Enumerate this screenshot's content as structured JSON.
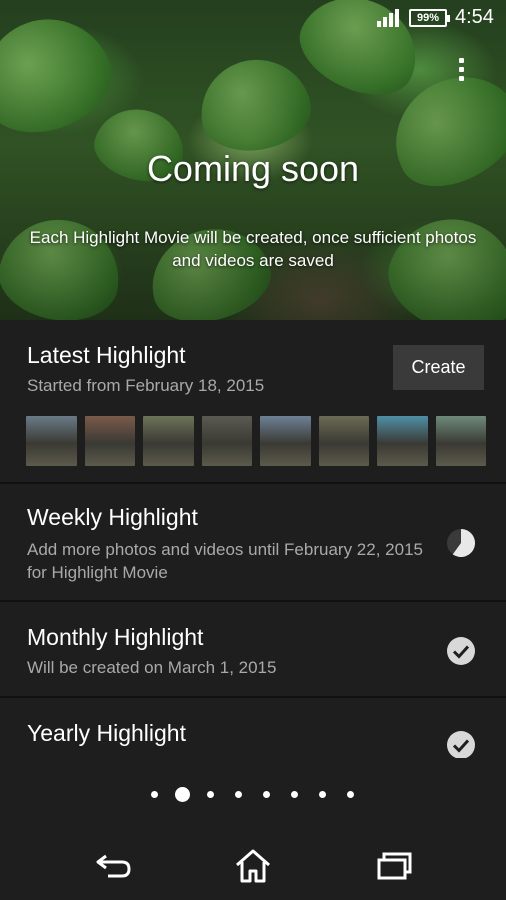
{
  "status_bar": {
    "battery": "99%",
    "time": "4:54"
  },
  "hero": {
    "title": "Coming soon",
    "description": "Each Highlight Movie will be created, once sufficient photos and videos are saved"
  },
  "latest": {
    "title": "Latest Highlight",
    "subtitle": "Started from February 18, 2015",
    "create_label": "Create",
    "thumbnail_colors": [
      "#6a7a86",
      "#7a5a4a",
      "#6d7358",
      "#5a5a52",
      "#6e8096",
      "#6b6a55",
      "#4f8fa6",
      "#6f8a7a"
    ]
  },
  "weekly": {
    "title": "Weekly Highlight",
    "subtitle": "Add more photos and videos until February 22, 2015 for Highlight Movie",
    "status_icon": "progress-pie-icon",
    "progress": 0.6
  },
  "monthly": {
    "title": "Monthly Highlight",
    "subtitle": "Will be created on March 1, 2015",
    "status_icon": "check-icon"
  },
  "yearly": {
    "title": "Yearly Highlight",
    "status_icon": "check-icon"
  },
  "pager": {
    "count": 8,
    "active_index": 1
  },
  "nav": {
    "back_icon": "back-icon",
    "home_icon": "home-icon",
    "recent_icon": "recent-apps-icon"
  }
}
